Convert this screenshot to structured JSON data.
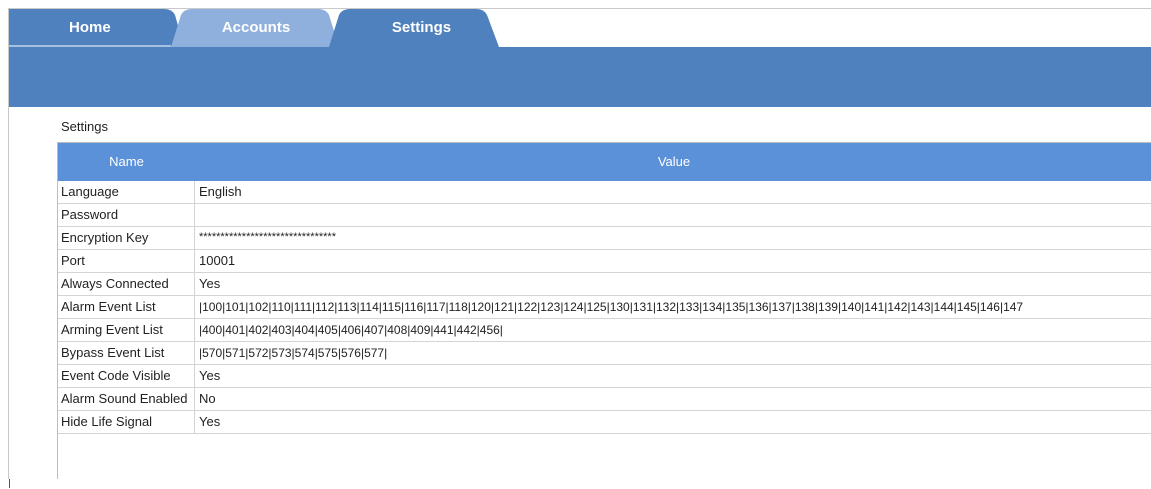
{
  "tabs": [
    {
      "label": "Home",
      "color": "#4e81bd",
      "active": false
    },
    {
      "label": "Accounts",
      "color": "#8fb0dc",
      "active": false
    },
    {
      "label": "Settings",
      "color": "#4e81bd",
      "active": true
    }
  ],
  "section_title": "Settings",
  "grid": {
    "header_name": "Name",
    "header_value": "Value",
    "rows": [
      {
        "name": "Language",
        "value": "English"
      },
      {
        "name": "Password",
        "value": ""
      },
      {
        "name": "Encryption Key",
        "value": "********************************"
      },
      {
        "name": "Port",
        "value": "10001"
      },
      {
        "name": "Always Connected",
        "value": "Yes"
      },
      {
        "name": "Alarm Event List",
        "value": "|100|101|102|110|111|112|113|114|115|116|117|118|120|121|122|123|124|125|130|131|132|133|134|135|136|137|138|139|140|141|142|143|144|145|146|147"
      },
      {
        "name": "Arming Event List",
        "value": "|400|401|402|403|404|405|406|407|408|409|441|442|456|"
      },
      {
        "name": "Bypass Event List",
        "value": "|570|571|572|573|574|575|576|577|"
      },
      {
        "name": "Event Code Visible",
        "value": "Yes"
      },
      {
        "name": "Alarm Sound Enabled",
        "value": "No"
      },
      {
        "name": "Hide Life Signal",
        "value": "Yes"
      }
    ]
  },
  "colors": {
    "banner": "#4e81bd",
    "grid_header": "#5a91d9"
  }
}
